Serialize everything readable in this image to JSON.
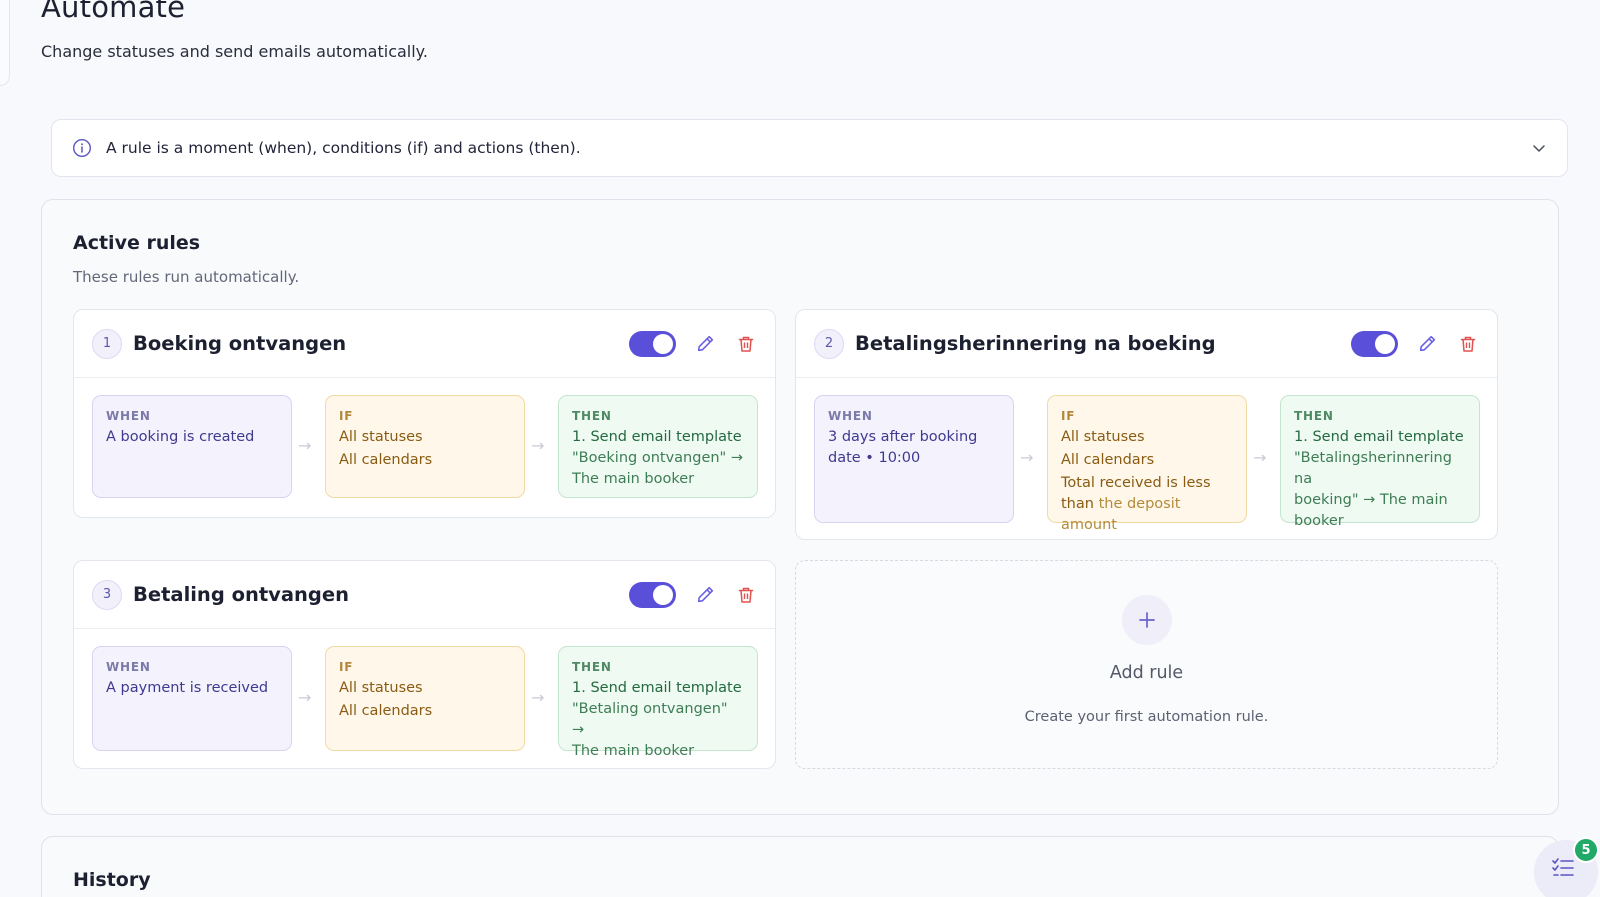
{
  "page": {
    "title": "Automate",
    "subtitle": "Change statuses and send emails automatically."
  },
  "info": {
    "text": "A rule is a moment (when), conditions (if) and actions (then).",
    "icon": "info-circle-icon",
    "toggle_icon": "chevron-down-icon"
  },
  "active_rules": {
    "title": "Active rules",
    "subtitle": "These rules run automatically.",
    "labels": {
      "when": "WHEN",
      "if": "IF",
      "then": "THEN"
    },
    "rules": [
      {
        "number": "1",
        "title": "Boeking ontvangen",
        "enabled": true,
        "when": [
          "A booking is created"
        ],
        "if": [
          "All statuses",
          "All calendars"
        ],
        "then": [
          "1. Send email template",
          "\"Boeking ontvangen\" →",
          "The main booker"
        ]
      },
      {
        "number": "2",
        "title": "Betalingsherinnering na boeking",
        "enabled": true,
        "when": [
          "3 days after booking",
          "date • 10:00"
        ],
        "if": [
          "All statuses",
          "All calendars",
          "Total received is less",
          "than",
          "the deposit amount"
        ],
        "then": [
          "1. Send email template",
          "\"Betalingsherinnering na",
          "boeking\" → The main",
          "booker"
        ]
      },
      {
        "number": "3",
        "title": "Betaling ontvangen",
        "enabled": true,
        "when": [
          "A payment is received"
        ],
        "if": [
          "All statuses",
          "All calendars"
        ],
        "then": [
          "1. Send email template",
          "\"Betaling ontvangen\" →",
          "The main booker"
        ]
      }
    ],
    "add_rule": {
      "label": "Add rule",
      "subtitle": "Create your first automation rule."
    }
  },
  "history": {
    "title": "History"
  },
  "fab": {
    "badge": "5",
    "icon": "checklist-icon"
  },
  "colors": {
    "accent": "#5a4fd8",
    "delete": "#e0524f",
    "success": "#21a967"
  }
}
